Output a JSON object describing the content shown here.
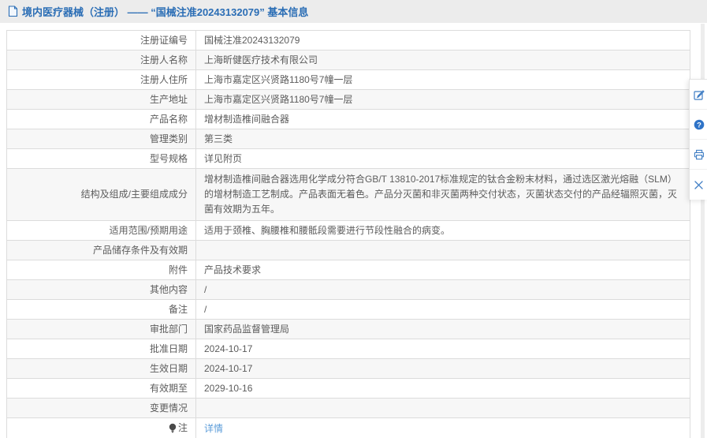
{
  "header": {
    "title": "境内医疗器械（注册） —— “国械注准20243132079” 基本信息"
  },
  "table": {
    "rows": [
      {
        "label": "注册证编号",
        "value": "国械注准20243132079"
      },
      {
        "label": "注册人名称",
        "value": "上海昕健医疗技术有限公司"
      },
      {
        "label": "注册人住所",
        "value": "上海市嘉定区兴贤路1180号7幢一层"
      },
      {
        "label": "生产地址",
        "value": "上海市嘉定区兴贤路1180号7幢一层"
      },
      {
        "label": "产品名称",
        "value": "增材制造椎间融合器"
      },
      {
        "label": "管理类别",
        "value": "第三类"
      },
      {
        "label": "型号规格",
        "value": "详见附页"
      },
      {
        "label": "结构及组成/主要组成成分",
        "value": "增材制造椎间融合器选用化学成分符合GB/T 13810-2017标准规定的钛合金粉末材料，通过选区激光熔融（SLM）的增材制造工艺制成。产品表面无着色。产品分灭菌和非灭菌两种交付状态，灭菌状态交付的产品经辐照灭菌，灭菌有效期为五年。"
      },
      {
        "label": "适用范围/预期用途",
        "value": "适用于颈椎、胸腰椎和腰骶段需要进行节段性融合的病变。"
      },
      {
        "label": "产品储存条件及有效期",
        "value": ""
      },
      {
        "label": "附件",
        "value": "产品技术要求"
      },
      {
        "label": "其他内容",
        "value": "/"
      },
      {
        "label": "备注",
        "value": "/"
      },
      {
        "label": "审批部门",
        "value": "国家药品监督管理局"
      },
      {
        "label": "批准日期",
        "value": "2024-10-17"
      },
      {
        "label": "生效日期",
        "value": "2024-10-17"
      },
      {
        "label": "有效期至",
        "value": "2029-10-16"
      },
      {
        "label": "变更情况",
        "value": ""
      },
      {
        "label": "注",
        "value": "详情",
        "note_icon": "bulb-icon",
        "value_is_link": "true"
      }
    ]
  },
  "toolbar": {
    "items": [
      {
        "name": "edit",
        "icon": "edit-icon"
      },
      {
        "name": "help",
        "icon": "help-icon",
        "glyph": "?"
      },
      {
        "name": "print",
        "icon": "print-icon"
      },
      {
        "name": "close",
        "icon": "close-icon"
      }
    ]
  },
  "colors": {
    "title_blue": "#2a6db5",
    "link_blue": "#5b9cd9",
    "icon_blue": "#3f7dc4",
    "help_fill": "#2f74c8",
    "header_bar": "#ececec",
    "row_alt": "#f7f7f7",
    "border": "#dcdcdc"
  }
}
